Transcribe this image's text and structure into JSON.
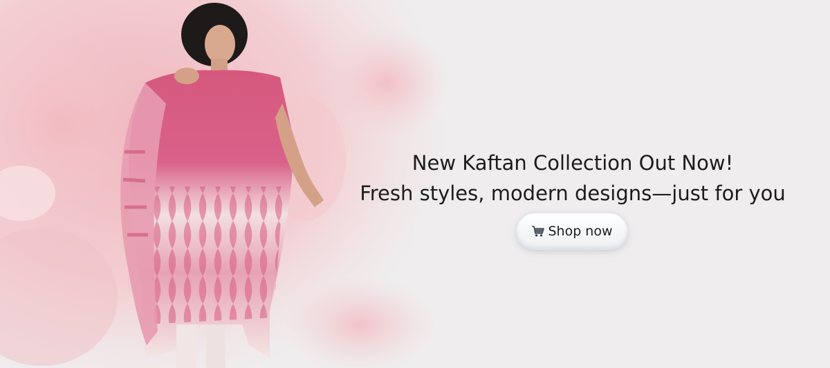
{
  "banner": {
    "headline_line1": "New Kaftan Collection Out Now!",
    "headline_line2": "Fresh styles, modern designs—just for you",
    "cta": {
      "label": "Shop now",
      "icon": "shopping-cart-icon"
    }
  },
  "colors": {
    "background": "#efedee",
    "watercolor_pink": "#f2bcc3",
    "kaftan_pink": "#d6587e",
    "kaftan_white": "#f6ece9",
    "text": "#1c1c1c"
  }
}
